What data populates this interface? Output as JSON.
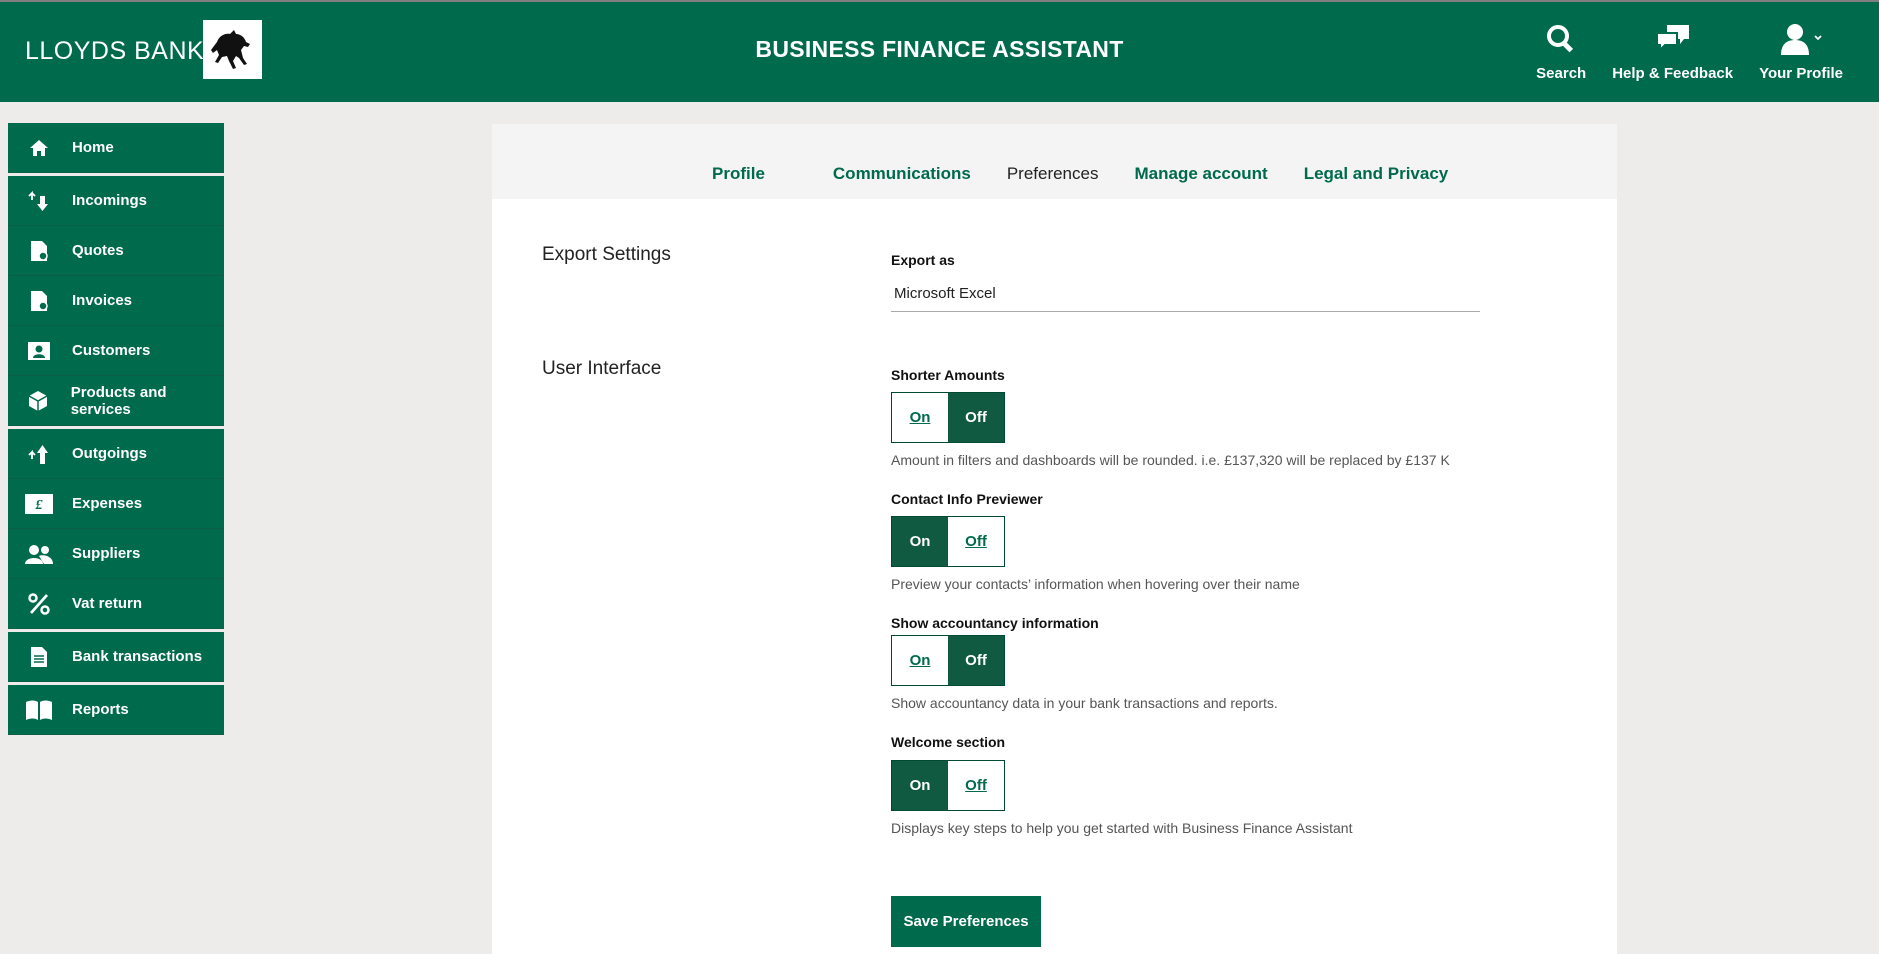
{
  "header": {
    "brand": "LLOYDS BANK",
    "app_title": "BUSINESS FINANCE ASSISTANT",
    "actions": {
      "search": "Search",
      "help": "Help & Feedback",
      "profile": "Your Profile"
    }
  },
  "sidebar": {
    "items": [
      {
        "label": "Home",
        "icon": "home-icon"
      },
      {
        "label": "Incomings",
        "icon": "incomings-icon"
      },
      {
        "label": "Quotes",
        "icon": "quotes-icon"
      },
      {
        "label": "Invoices",
        "icon": "invoices-icon"
      },
      {
        "label": "Customers",
        "icon": "customers-icon"
      },
      {
        "label": "Products and services",
        "icon": "products-icon"
      },
      {
        "label": "Outgoings",
        "icon": "outgoings-icon"
      },
      {
        "label": "Expenses",
        "icon": "expenses-icon"
      },
      {
        "label": "Suppliers",
        "icon": "suppliers-icon"
      },
      {
        "label": "Vat return",
        "icon": "percent-icon"
      },
      {
        "label": "Bank transactions",
        "icon": "bank-transactions-icon"
      },
      {
        "label": "Reports",
        "icon": "reports-icon"
      }
    ]
  },
  "tabs": [
    {
      "label": "Profile"
    },
    {
      "label": "Communications"
    },
    {
      "label": "Preferences",
      "active": true
    },
    {
      "label": "Manage account"
    },
    {
      "label": "Legal and Privacy"
    }
  ],
  "export": {
    "section_title": "Export Settings",
    "label": "Export as",
    "value": "Microsoft Excel"
  },
  "ui": {
    "section_title": "User Interface",
    "settings": [
      {
        "label": "Shorter Amounts",
        "on": "On",
        "off": "Off",
        "selected": "Off",
        "help": "Amount in filters and dashboards will be rounded. i.e. £137,320 will be replaced by £137 K"
      },
      {
        "label": "Contact Info Previewer",
        "on": "On",
        "off": "Off",
        "selected": "On",
        "help": "Preview your contacts’ information when hovering over their name"
      },
      {
        "label": "Show accountancy information",
        "on": "On",
        "off": "Off",
        "selected": "Off",
        "help": "Show accountancy data in your bank transactions and reports."
      },
      {
        "label": "Welcome section",
        "on": "On",
        "off": "Off",
        "selected": "On",
        "help": "Displays key steps to help you get started with Business Finance Assistant"
      }
    ]
  },
  "save_label": "Save Preferences",
  "colors": {
    "brand_green": "#006a4d",
    "selected_green": "#0f5a41",
    "page_bg": "#edecea"
  }
}
